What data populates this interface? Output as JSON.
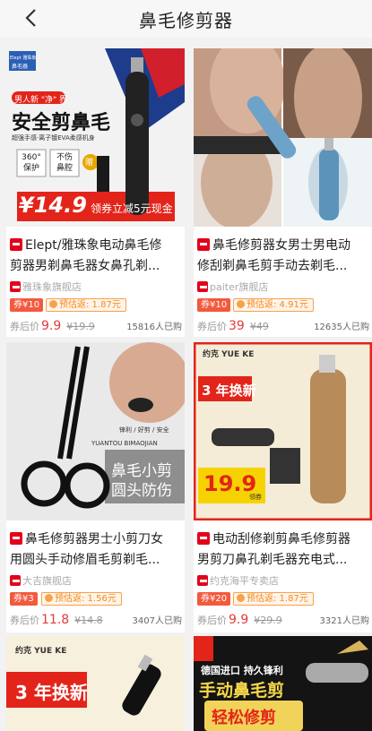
{
  "header": {
    "title": "鼻毛修剪器"
  },
  "products": [
    {
      "line1": "Elept/雅珠象电动鼻毛修",
      "line2": "剪器男剃鼻毛器女鼻孔剃...",
      "shop": "雅珠象旗舰店",
      "coupon": "券¥10",
      "rebate": "预估返: 1.87元",
      "after_label": "券后价",
      "price": "9.9",
      "original": "¥19.9",
      "sold": "15816人已购",
      "image_text": {
        "logo": "Elept 雅珠象",
        "tag": "鼻毛器",
        "slogan": "男人新 \"净\" 界",
        "headline": "安全剪鼻毛",
        "sub": "超强手感·离子镀EVA柔感机身",
        "f1a": "360°",
        "f1b": "保护",
        "f2a": "不伤",
        "f2b": "鼻腔",
        "gift": "赠",
        "price_tag": "¥14.9",
        "promo": "领券立减5元现金"
      }
    },
    {
      "line1": "鼻毛修剪器女男士男电动",
      "line2": "修刮剃鼻毛剪手动去剃毛...",
      "shop": "paiter旗舰店",
      "coupon": "券¥10",
      "rebate": "预估返: 4.91元",
      "after_label": "券后价",
      "price": "39",
      "original": "¥49",
      "sold": "12635人已购"
    },
    {
      "line1": "鼻毛修剪器男士小剪刀女",
      "line2": "用圆头手动修眉毛剪剃毛...",
      "shop": "大吉旗舰店",
      "coupon": "券¥3",
      "rebate": "预估返: 1.56元",
      "after_label": "券后价",
      "price": "11.8",
      "original": "¥14.8",
      "sold": "3407人已购",
      "image_text": {
        "labels": "锋利 / 好剪 / 安全",
        "brand": "YUANTOU BIMAOJIAN",
        "name1": "鼻毛小剪",
        "name2": "圆头防伤"
      }
    },
    {
      "line1": "电动刮修剃剪鼻毛修剪器",
      "line2": "男剪刀鼻孔剃毛器充电式...",
      "shop": "约克海平专卖店",
      "coupon": "券¥20",
      "rebate": "预估返: 1.87元",
      "after_label": "券后价",
      "price": "9.9",
      "original": "¥29.9",
      "sold": "3321人已购",
      "image_text": {
        "logo": "约克 YUE KE",
        "promo": "3 年换新",
        "price_tag": "19.9",
        "price_sub": "领券"
      }
    }
  ],
  "partial": [
    {
      "logo": "约克 YUE KE",
      "promo": "3 年换新"
    },
    {
      "line1": "德国进口 持久锋利",
      "line2": "手动鼻毛剪",
      "line3": "轻松修剪"
    }
  ]
}
